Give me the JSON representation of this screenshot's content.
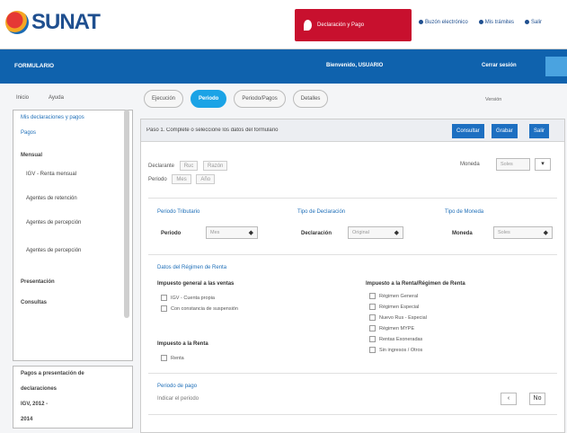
{
  "brand": {
    "logo_text": "SUNAT"
  },
  "topbar": {
    "red_button_label": "Declaración y Pago",
    "links": [
      "Buzón electrónico",
      "Mis trámites",
      "Salir"
    ]
  },
  "nav": {
    "title": "FORMULARIO",
    "user": "Bienvenido, USUARIO",
    "session": "Cerrar sesión"
  },
  "sidebar": {
    "top_links": [
      "Inicio",
      "Ayuda"
    ],
    "items": [
      {
        "label": "Mis declaraciones y pagos",
        "style": "link"
      },
      {
        "label": "Pagos",
        "style": "link"
      },
      {
        "label": "Mensual",
        "style": "bold"
      },
      {
        "label": "IGV - Renta mensual",
        "style": "sub"
      },
      {
        "label": "Agentes de retención",
        "style": "sub"
      },
      {
        "label": "Agentes de percepción",
        "style": "sub"
      },
      {
        "label": "Agentes de percepción",
        "style": "sub"
      },
      {
        "label": "Presentación",
        "style": "bold"
      },
      {
        "label": "Consultas",
        "style": "bold"
      }
    ],
    "box2_items": [
      "Pagos a presentación de",
      "declaraciones",
      "IGV, 2012 -",
      "2014"
    ]
  },
  "tabs": {
    "items": [
      "Ejecución",
      "Periodo",
      "Periodo/Pagos",
      "Detalles"
    ],
    "active_index": 1,
    "right_text": "Versión"
  },
  "panel": {
    "step_text": "Paso 1. Complete o seleccione los datos del formulario",
    "step_buttons": [
      "Consultar",
      "Grabar",
      "Salir"
    ],
    "declarant": {
      "label": "Declarante",
      "chips": [
        "Ruc",
        "Razón"
      ],
      "label2": "Periodo",
      "chips2": [
        "Mes",
        "Año"
      ]
    },
    "currency": {
      "label": "Moneda",
      "value": "Soles"
    },
    "periodo_section": "Periodo Tributario",
    "periodo_label": "Periodo",
    "periodo_value": "Mes",
    "tipo_section": "Tipo de Declaración",
    "tipo_label": "Declaración",
    "tipo_value": "Original",
    "moneda_section": "Tipo de Moneda",
    "moneda_label": "Moneda",
    "moneda_value": "Soles",
    "regimen_section": "Datos del Régimen de Renta",
    "left_group_title": "Impuesto general a las ventas",
    "left_checks": [
      "IGV - Cuenta propia",
      "Con constancia de suspensión"
    ],
    "left_group_title2": "Impuesto a la Renta",
    "left_checks2": [
      "Renta"
    ],
    "right_group_title": "Impuesto a la Renta/Régimen de Renta",
    "right_checks": [
      "Régimen General",
      "Régimen Especial",
      "Nuevo Rus - Especial",
      "Régimen MYPE",
      "Rentas Exoneradas",
      "Sin ingresos / Otros"
    ],
    "bottom_section": "Periodo de pago",
    "bottom_text": "Indicar el periodo",
    "bottom_value": "No"
  }
}
